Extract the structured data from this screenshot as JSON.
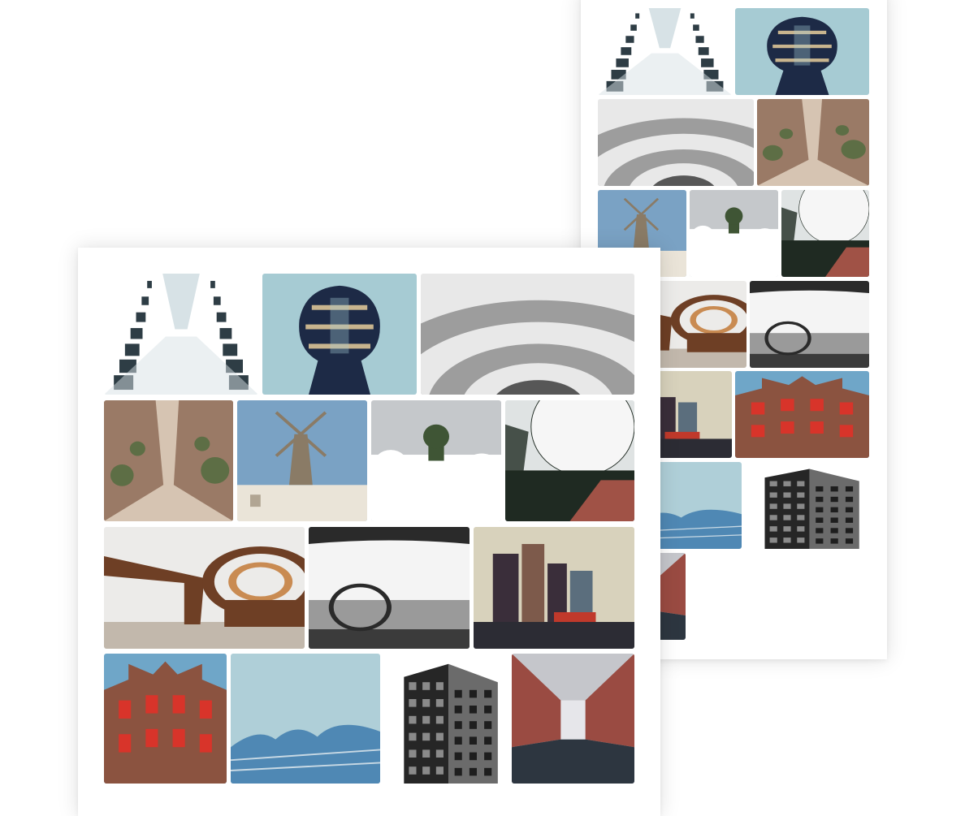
{
  "palette": {
    "page_background": "#ffffff",
    "card_background": "#ffffff"
  },
  "gallery_layouts": [
    {
      "name": "vertical-masonry-preview",
      "photos": [
        {
          "subject": "facade-looking-up",
          "palette": [
            "#d7e2e6",
            "#ffffff",
            "#2e3d45"
          ]
        },
        {
          "subject": "round-tower",
          "palette": [
            "#a6cbd3",
            "#1d2a46",
            "#c8b48e"
          ]
        },
        {
          "subject": "spiral-staircase",
          "palette": [
            "#9d9d9d",
            "#e8e8e8",
            "#575757"
          ]
        },
        {
          "subject": "village-alley",
          "palette": [
            "#9a7a66",
            "#5d6e45",
            "#d6c4b2"
          ]
        },
        {
          "subject": "windmill",
          "palette": [
            "#7aa2c4",
            "#eae4d8",
            "#8a7b66"
          ]
        },
        {
          "subject": "radar-dome-forest",
          "palette": [
            "#c5c8cb",
            "#3f5535",
            "#ffffff"
          ]
        },
        {
          "subject": "radar-dome-closeup",
          "palette": [
            "#dfe3e3",
            "#1f2a22",
            "#a05246"
          ]
        },
        {
          "subject": "wooden-sculpture",
          "palette": [
            "#ecebe9",
            "#6e3f25",
            "#c98b52"
          ]
        },
        {
          "subject": "vintage-car-interior",
          "palette": [
            "#f4f4f4",
            "#2a2a2a",
            "#9a9a9a"
          ]
        },
        {
          "subject": "canal-houses",
          "palette": [
            "#d8d2bc",
            "#3a2e3a",
            "#c0392b"
          ]
        },
        {
          "subject": "red-shutters",
          "palette": [
            "#6fa6c8",
            "#8b5340",
            "#d8342a"
          ]
        },
        {
          "subject": "elbphilharmonie",
          "palette": [
            "#afcfd8",
            "#4f88b4",
            "#e7eef1"
          ]
        },
        {
          "subject": "dark-brick-building",
          "palette": [
            "#ffffff",
            "#262626",
            "#6b6b6b"
          ]
        },
        {
          "subject": "red-brick-canal",
          "palette": [
            "#c5c6cb",
            "#9a4b42",
            "#2d3640"
          ]
        }
      ]
    },
    {
      "name": "justified-rows-preview",
      "photos": [
        {
          "subject": "facade-looking-up",
          "palette": [
            "#d7e2e6",
            "#ffffff",
            "#2e3d45"
          ]
        },
        {
          "subject": "round-tower",
          "palette": [
            "#a6cbd3",
            "#1d2a46",
            "#c8b48e"
          ]
        },
        {
          "subject": "spiral-staircase",
          "palette": [
            "#9d9d9d",
            "#e8e8e8",
            "#575757"
          ]
        },
        {
          "subject": "village-alley",
          "palette": [
            "#9a7a66",
            "#5d6e45",
            "#d6c4b2"
          ]
        },
        {
          "subject": "windmill",
          "palette": [
            "#7aa2c4",
            "#eae4d8",
            "#8a7b66"
          ]
        },
        {
          "subject": "radar-dome-forest",
          "palette": [
            "#c5c8cb",
            "#3f5535",
            "#ffffff"
          ]
        },
        {
          "subject": "radar-dome-closeup",
          "palette": [
            "#dfe3e3",
            "#1f2a22",
            "#a05246"
          ]
        },
        {
          "subject": "wooden-sculpture",
          "palette": [
            "#ecebe9",
            "#6e3f25",
            "#c98b52"
          ]
        },
        {
          "subject": "vintage-car-interior",
          "palette": [
            "#f4f4f4",
            "#2a2a2a",
            "#9a9a9a"
          ]
        },
        {
          "subject": "canal-houses",
          "palette": [
            "#d8d2bc",
            "#3a2e3a",
            "#c0392b"
          ]
        },
        {
          "subject": "red-shutters",
          "palette": [
            "#6fa6c8",
            "#8b5340",
            "#d8342a"
          ]
        },
        {
          "subject": "elbphilharmonie",
          "palette": [
            "#afcfd8",
            "#4f88b4",
            "#e7eef1"
          ]
        },
        {
          "subject": "dark-brick-building",
          "palette": [
            "#ffffff",
            "#262626",
            "#6b6b6b"
          ]
        },
        {
          "subject": "red-brick-canal",
          "palette": [
            "#c5c6cb",
            "#9a4b42",
            "#2d3640"
          ]
        }
      ]
    }
  ]
}
